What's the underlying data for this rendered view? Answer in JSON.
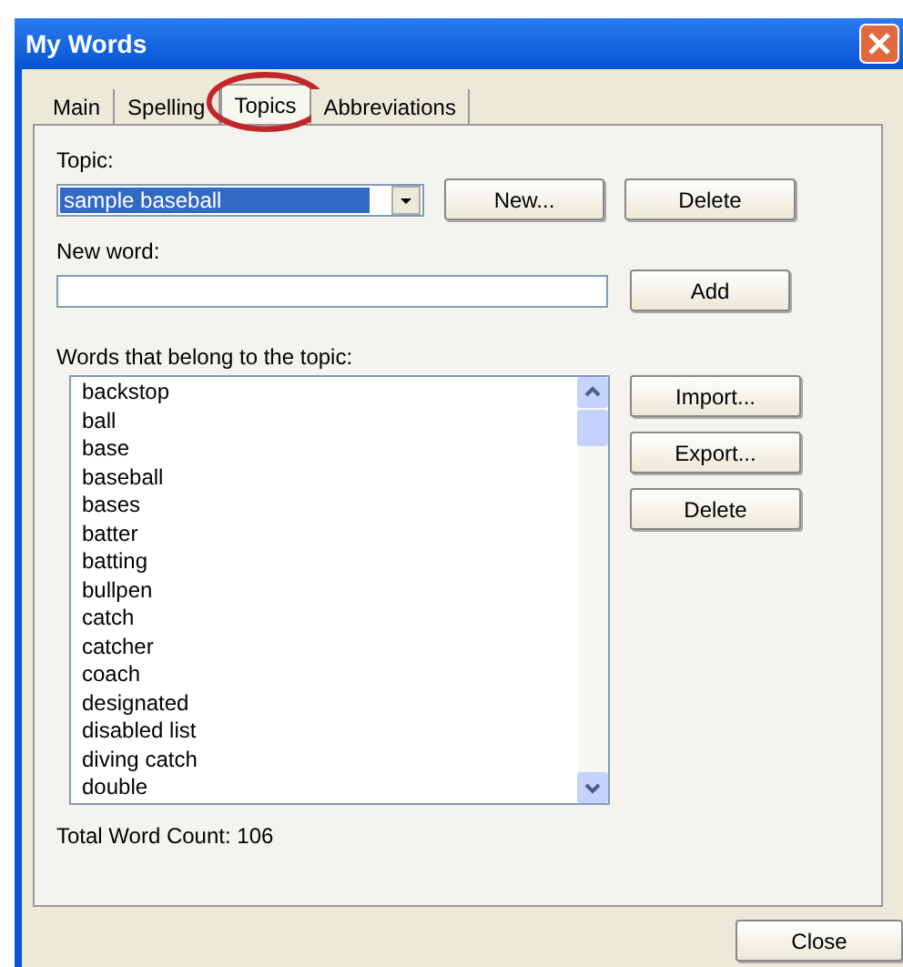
{
  "window": {
    "title": "My Words"
  },
  "tabs": [
    {
      "label": "Main",
      "selected": false,
      "circled": false
    },
    {
      "label": "Spelling",
      "selected": false,
      "circled": false
    },
    {
      "label": "Topics",
      "selected": true,
      "circled": true
    },
    {
      "label": "Abbreviations",
      "selected": false,
      "circled": false
    }
  ],
  "topic": {
    "label": "Topic:",
    "value": "sample baseball",
    "buttons": [
      "New...",
      "Delete"
    ]
  },
  "new_word": {
    "label": "New word:",
    "button": "Add"
  },
  "words": {
    "label": "Words that belong to the topic:",
    "items": [
      "backstop",
      "ball",
      "base",
      "baseball",
      "bases",
      "batter",
      "batting",
      "bullpen",
      "catch",
      "catcher",
      "coach",
      "designated",
      "disabled list",
      "diving catch",
      "double"
    ],
    "buttons": [
      "Import...",
      "Export...",
      "Delete"
    ]
  },
  "total": "Total Word Count: 106",
  "close_button": "Close"
}
